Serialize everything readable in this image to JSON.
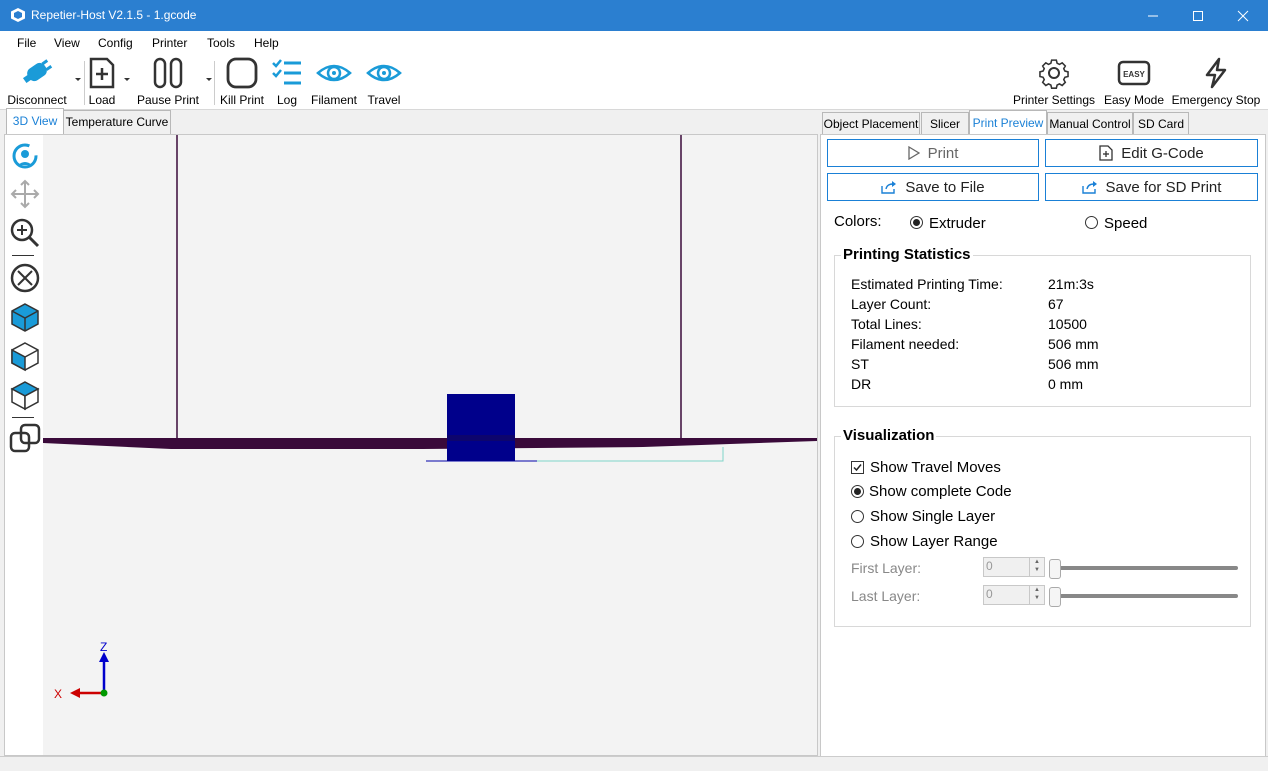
{
  "window": {
    "title": "Repetier-Host V2.1.5 - 1.gcode"
  },
  "menu": [
    "File",
    "View",
    "Config",
    "Printer",
    "Tools",
    "Help"
  ],
  "toolbar": {
    "disconnect": "Disconnect",
    "load": "Load",
    "pause": "Pause Print",
    "kill": "Kill Print",
    "log": "Log",
    "filament": "Filament",
    "travel": "Travel",
    "printer_settings": "Printer Settings",
    "easy_mode": "Easy Mode",
    "easy_badge": "EASY",
    "emergency_stop": "Emergency Stop"
  },
  "left_tabs": [
    "3D View",
    "Temperature Curve"
  ],
  "axes": {
    "x": "X",
    "z": "Z"
  },
  "right_tabs": [
    "Object Placement",
    "Slicer",
    "Print Preview",
    "Manual Control",
    "SD Card"
  ],
  "preview": {
    "print": "Print",
    "edit_gcode": "Edit G-Code",
    "save_file": "Save to File",
    "save_sd": "Save for SD Print",
    "colors_label": "Colors:",
    "color_extruder": "Extruder",
    "color_speed": "Speed"
  },
  "stats": {
    "title": "Printing Statistics",
    "rows": [
      {
        "label": "Estimated Printing Time:",
        "value": "21m:3s"
      },
      {
        "label": "Layer Count:",
        "value": "67"
      },
      {
        "label": "Total Lines:",
        "value": "10500"
      },
      {
        "label": "Filament needed:",
        "value": "506 mm"
      },
      {
        "label": "ST",
        "value": "506 mm"
      },
      {
        "label": "DR",
        "value": "0 mm"
      }
    ]
  },
  "visualization": {
    "title": "Visualization",
    "travel": "Show Travel Moves",
    "complete": "Show complete Code",
    "single": "Show Single Layer",
    "range": "Show Layer Range",
    "first": "First Layer:",
    "last": "Last Layer:",
    "first_value": "0",
    "last_value": "0"
  },
  "colors": {
    "accent": "#1a80d6",
    "titlebar": "#2b7fd0",
    "model": "#00008b",
    "bed": "#3a0a3a"
  }
}
